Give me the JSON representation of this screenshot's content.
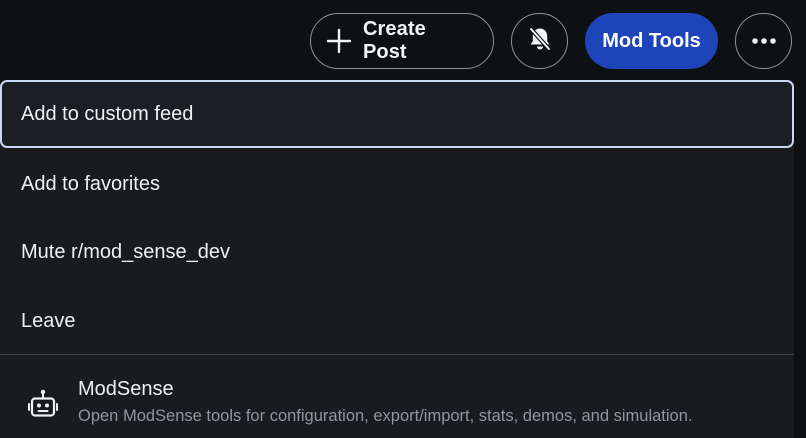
{
  "header": {
    "create_post_label": "Create Post",
    "mod_tools_label": "Mod Tools",
    "icons": {
      "create": "plus-icon",
      "notifications": "bell-off-icon",
      "more": "more-horizontal-icon"
    }
  },
  "menu": {
    "items": [
      {
        "label": "Add to custom feed"
      },
      {
        "label": "Add to favorites"
      },
      {
        "label": "Mute r/mod_sense_dev"
      },
      {
        "label": "Leave"
      }
    ],
    "app": {
      "icon": "robot-icon",
      "title": "ModSense",
      "description": "Open ModSense tools for configuration, export/import, stats, demos, and simulation."
    }
  },
  "colors": {
    "background": "#0e1113",
    "menu_background": "#181c1f",
    "accent": "#1d44b8",
    "focus_ring": "#c9d7f2",
    "muted_text": "#8d979f"
  }
}
